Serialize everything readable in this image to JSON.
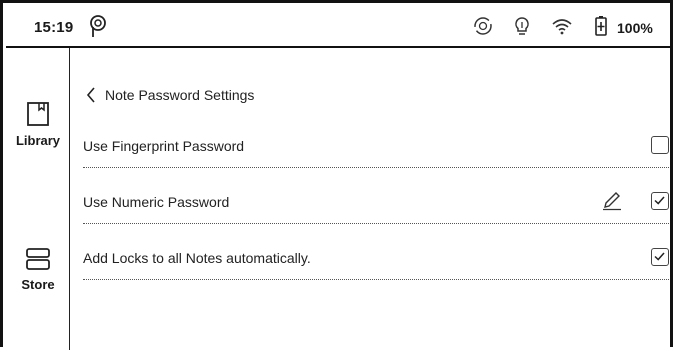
{
  "status_bar": {
    "time": "15:19",
    "battery_percent": "100%",
    "icons": [
      "p-logo-icon",
      "sync-icon",
      "bulb-icon",
      "wifi-icon",
      "battery-icon"
    ]
  },
  "sidebar": {
    "items": [
      {
        "label": "Library",
        "icon": "book-icon"
      },
      {
        "label": "Store",
        "icon": "store-icon"
      }
    ]
  },
  "page": {
    "title": "Note Password Settings",
    "back_icon": "chevron-left-icon"
  },
  "settings": [
    {
      "label": "Use Fingerprint Password",
      "checked": false,
      "has_edit": false
    },
    {
      "label": "Use Numeric Password",
      "checked": true,
      "has_edit": true
    },
    {
      "label": "Add Locks to all Notes automatically.",
      "checked": true,
      "has_edit": false
    }
  ]
}
